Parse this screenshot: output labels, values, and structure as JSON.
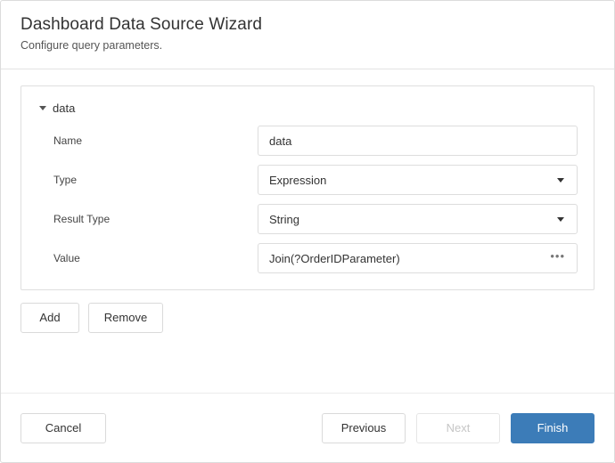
{
  "window": {
    "title": "Dashboard Data Source Wizard",
    "subtitle": "Configure query parameters."
  },
  "panel": {
    "name": "data",
    "collapse_icon": "caret-down-icon",
    "rows": [
      {
        "label": "Name",
        "value": "data",
        "control": "textbox"
      },
      {
        "label": "Type",
        "value": "Expression",
        "control": "dropdown"
      },
      {
        "label": "Result Type",
        "value": "String",
        "control": "dropdown"
      },
      {
        "label": "Value",
        "value": "Join(?OrderIDParameter)",
        "control": "textbox-ellipsis",
        "ellipsis_label": "•••"
      }
    ],
    "actions": {
      "add_label": "Add",
      "remove_label": "Remove"
    }
  },
  "footer": {
    "cancel_label": "Cancel",
    "previous_label": "Previous",
    "next_label": "Next",
    "finish_label": "Finish",
    "next_disabled": true
  },
  "colors": {
    "primary": "#3c7cb8",
    "border": "#dddddd",
    "text": "#333333",
    "label_text": "#444444",
    "disabled_text": "#c6c6c6"
  }
}
